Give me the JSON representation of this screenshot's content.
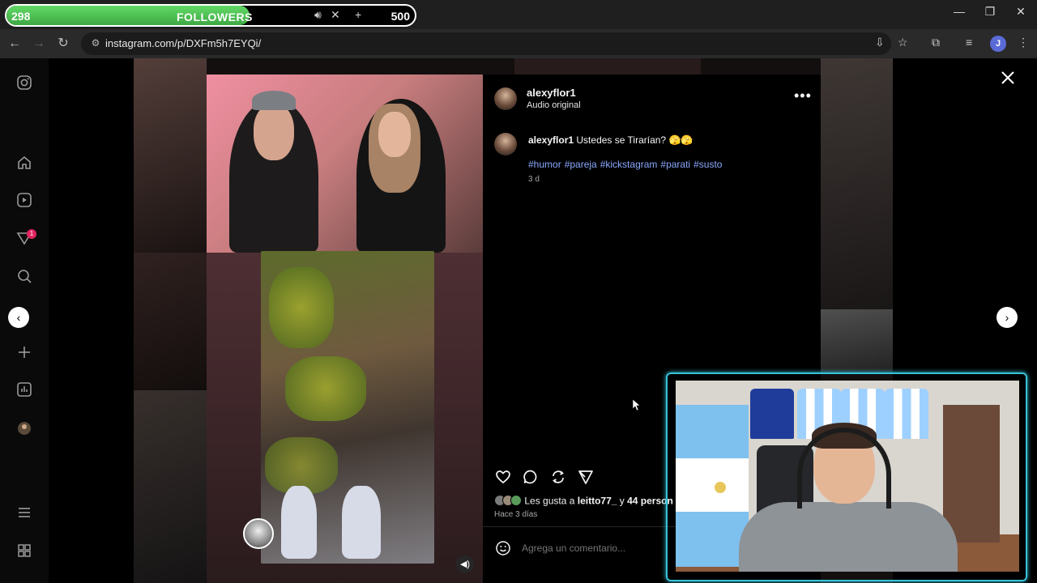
{
  "stream_overlay": {
    "followers_current": "298",
    "followers_label": "FOLLOWERS",
    "followers_goal": "500",
    "progress_fraction": 0.596
  },
  "browser": {
    "url": "instagram.com/p/DXFm5h7EYQi/",
    "profile_initial": "J"
  },
  "left_nav": {
    "notification_count": "1",
    "icons": [
      "instagram-icon",
      "home-icon",
      "reels-icon",
      "messages-icon",
      "search-icon",
      "create-icon",
      "dashboard-icon",
      "profile-icon",
      "menu-icon",
      "more-apps-icon"
    ]
  },
  "post": {
    "author": "alexyflor1",
    "audio": "Audio original",
    "caption_author": "alexyflor1",
    "caption_text": "Ustedes se Tirarían? 🫣🫣",
    "hashtags": [
      "#humor",
      "#pareja",
      "#kickstagram",
      "#parati",
      "#susto"
    ],
    "caption_age": "3 d",
    "likes_prefix": "Les gusta a",
    "likes_user": "leitto77_",
    "likes_suffix": "y",
    "likes_others": "44 person",
    "posted_ago": "Hace 3 días",
    "comment_placeholder": "Agrega un comentario..."
  },
  "colors": {
    "accent_link": "#8aa8ff",
    "progress_green": "#4cc253",
    "cam_border": "#36c2d8"
  }
}
